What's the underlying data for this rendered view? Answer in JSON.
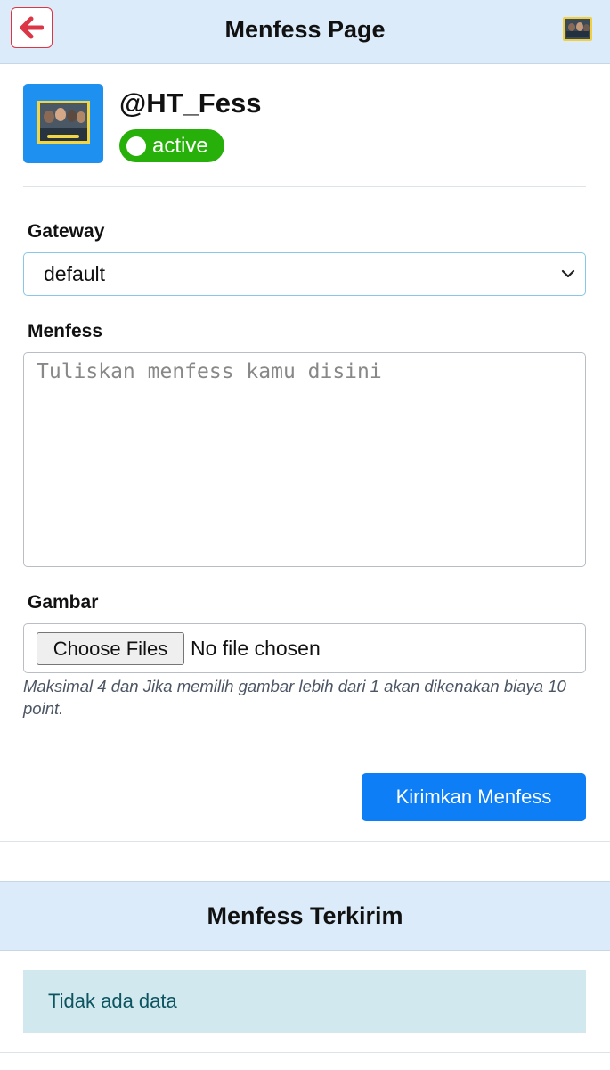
{
  "header": {
    "title": "Menfess Page",
    "back_icon": "arrow-left-icon",
    "accent_color": "#dc3545"
  },
  "profile": {
    "username": "@HT_Fess",
    "status": "active",
    "status_color": "#28b00a"
  },
  "form": {
    "gateway_label": "Gateway",
    "gateway_value": "default",
    "menfess_label": "Menfess",
    "menfess_placeholder": "Tuliskan menfess kamu disini",
    "gambar_label": "Gambar",
    "choose_files_label": "Choose Files",
    "file_status": "No file chosen",
    "help_text": "Maksimal 4 dan Jika memilih gambar lebih dari 1 akan dikenakan biaya 10 point.",
    "submit_label": "Kirimkan Menfess",
    "submit_color": "#0d7ef6"
  },
  "sent": {
    "title": "Menfess Terkirim",
    "empty_text": "Tidak ada data"
  }
}
